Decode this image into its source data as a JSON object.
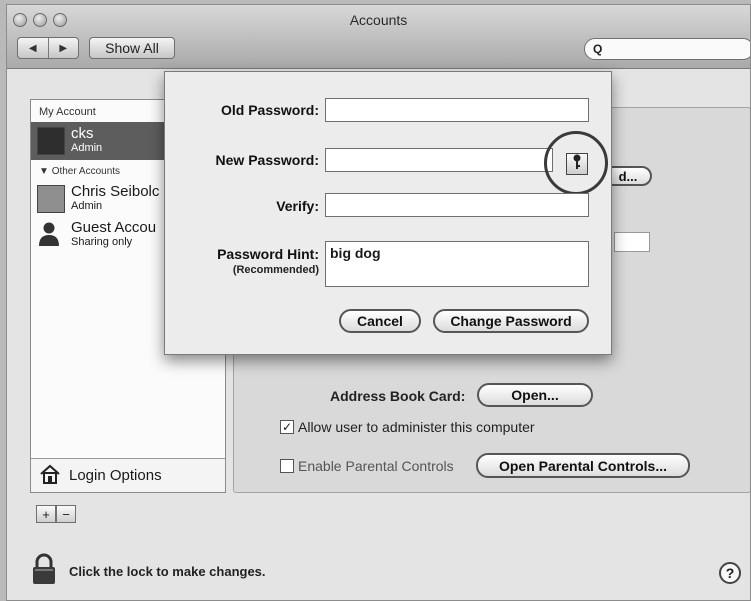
{
  "window": {
    "title": "Accounts"
  },
  "toolbar": {
    "back": "◀",
    "forward": "▶",
    "show_all": "Show All",
    "search_glyph": "Q"
  },
  "sidebar": {
    "my_account_header": "My Account",
    "other_accounts_header": "Other Accounts",
    "accounts": [
      {
        "name": "cks",
        "role": "Admin"
      },
      {
        "name": "Chris Seibolc",
        "role": "Admin"
      },
      {
        "name": "Guest Accou",
        "role": "Sharing only"
      }
    ],
    "login_options": "Login Options",
    "add": "+",
    "remove": "−"
  },
  "panel": {
    "address_book_label": "Address Book Card:",
    "open_button": "Open...",
    "allow_admin_label": "Allow user to administer this computer",
    "parental_label": "Enable Parental Controls",
    "open_parental_button": "Open Parental Controls...",
    "partial_button": "d..."
  },
  "sheet": {
    "old_password_label": "Old Password:",
    "new_password_label": "New Password:",
    "verify_label": "Verify:",
    "hint_label": "Password Hint:",
    "hint_sub": "(Recommended)",
    "hint_value": "big dog",
    "cancel": "Cancel",
    "change_password": "Change Password"
  },
  "footer": {
    "lock_text": "Click the lock to make changes.",
    "help": "?"
  }
}
